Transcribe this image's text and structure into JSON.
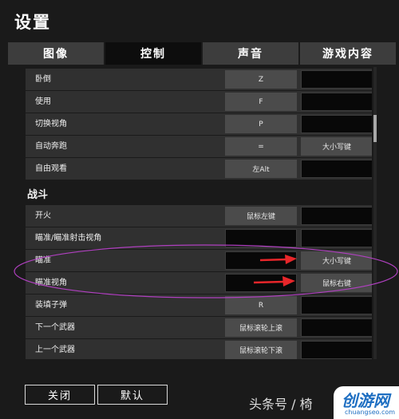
{
  "window": {
    "title": "设置"
  },
  "tabs": [
    {
      "label": "图像",
      "active": false
    },
    {
      "label": "控制",
      "active": true
    },
    {
      "label": "声音",
      "active": false
    },
    {
      "label": "游戏内容",
      "active": false
    }
  ],
  "sections": {
    "combat": "战斗"
  },
  "rows_general": [
    {
      "label": "卧倒",
      "key1": "Z",
      "key2": ""
    },
    {
      "label": "使用",
      "key1": "F",
      "key2": ""
    },
    {
      "label": "切换视角",
      "key1": "P",
      "key2": ""
    },
    {
      "label": "自动奔跑",
      "key1": "=",
      "key2": "大小写键"
    },
    {
      "label": "自由观看",
      "key1": "左Alt",
      "key2": ""
    }
  ],
  "rows_combat": [
    {
      "label": "开火",
      "key1": "鼠标左键",
      "key2": ""
    },
    {
      "label": "瞄准/瞄准射击视角",
      "key1": "",
      "key2": ""
    },
    {
      "label": "瞄准",
      "key1": "",
      "key2": "大小写键"
    },
    {
      "label": "瞄准视角",
      "key1": "",
      "key2": "鼠标右键"
    },
    {
      "label": "装填子弹",
      "key1": "R",
      "key2": ""
    },
    {
      "label": "下一个武器",
      "key1": "鼠标滚轮上滚",
      "key2": ""
    },
    {
      "label": "上一个武器",
      "key1": "鼠标滚轮下滚",
      "key2": ""
    }
  ],
  "footer": {
    "close_label": "关闭",
    "default_label": "默认"
  },
  "watermark": {
    "text": "头条号 / 椅",
    "logo_main": "创游网",
    "logo_sub": "chuangseo.com"
  },
  "colors": {
    "annotation_oval": "#b040c0",
    "annotation_arrow": "#e8262a",
    "background": "#1a1a1a"
  }
}
